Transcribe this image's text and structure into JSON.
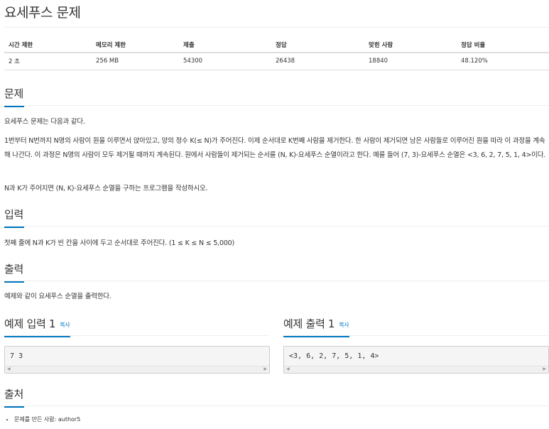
{
  "title": "요세푸스 문제",
  "info_table": {
    "headers": [
      "시간 제한",
      "메모리 제한",
      "제출",
      "정답",
      "맞힌 사람",
      "정답 비율"
    ],
    "values": [
      "2 초",
      "256 MB",
      "54300",
      "26438",
      "18840",
      "48.120%"
    ]
  },
  "problem": {
    "heading": "문제",
    "p1": "요세푸스 문제는 다음과 같다.",
    "p2": "1번부터 N번까지 N명의 사람이 원을 이루면서 앉아있고, 양의 정수 K(≤ N)가 주어진다. 이제 순서대로 K번째 사람을 제거한다. 한 사람이 제거되면 남은 사람들로 이루어진 원을 따라 이 과정을 계속해 나간다. 이 과정은 N명의 사람이 모두 제거될 때까지 계속된다. 원에서 사람들이 제거되는 순서를 (N, K)-요세푸스 순열이라고 한다. 예를 들어 (7, 3)-요세푸스 순열은 <3, 6, 2, 7, 5, 1, 4>이다.",
    "p3": "N과 K가 주어지면 (N, K)-요세푸스 순열을 구하는 프로그램을 작성하시오."
  },
  "input": {
    "heading": "입력",
    "text": "첫째 줄에 N과 K가 빈 칸을 사이에 두고 순서대로 주어진다. (1 ≤ K ≤ N ≤ 5,000)"
  },
  "output": {
    "heading": "출력",
    "text": "예제와 같이 요세푸스 순열을 출력한다."
  },
  "sample_input": {
    "heading": "예제 입력 1",
    "copy_label": "복사",
    "code": "7 3"
  },
  "sample_output": {
    "heading": "예제 출력 1",
    "copy_label": "복사",
    "code": "<3, 6, 2, 7, 5, 1, 4>"
  },
  "source": {
    "heading": "출처",
    "items": [
      "문제를 만든 사람: author5"
    ]
  },
  "scroll_arrows": {
    "left": "◀",
    "right": "▶"
  },
  "colors": {
    "accent": "#0076c0",
    "rule": "#eeeeee",
    "code_bg": "#f5f5f5"
  }
}
